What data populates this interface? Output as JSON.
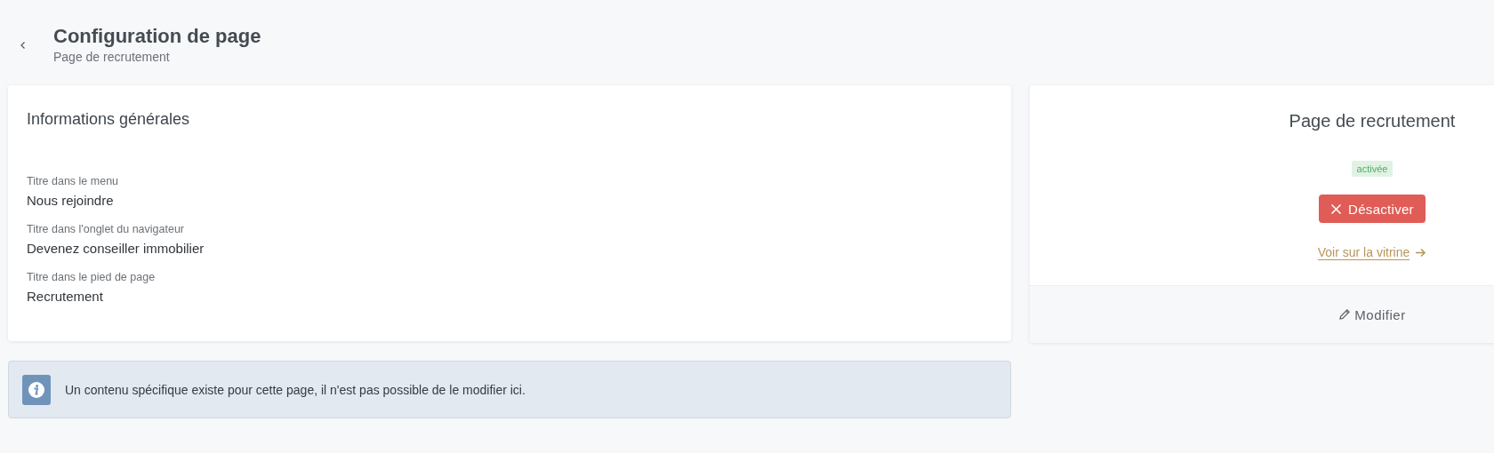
{
  "header": {
    "title": "Configuration de page",
    "subtitle": "Page de recrutement"
  },
  "general": {
    "title": "Informations générales",
    "fields": [
      {
        "label": "Titre dans le menu",
        "value": "Nous rejoindre"
      },
      {
        "label": "Titre dans l'onglet du navigateur",
        "value": "Devenez conseiller immobilier"
      },
      {
        "label": "Titre dans le pied de page",
        "value": "Recrutement"
      }
    ]
  },
  "notice": {
    "text": "Un contenu spécifique existe pour cette page, il n'est pas possible de le modifier ici."
  },
  "page_card": {
    "title": "Page de recrutement",
    "status": "activée",
    "active": true,
    "toggle_button": "Désactiver",
    "link": "Voir sur la vitrine",
    "edit_button": "Modifier"
  }
}
